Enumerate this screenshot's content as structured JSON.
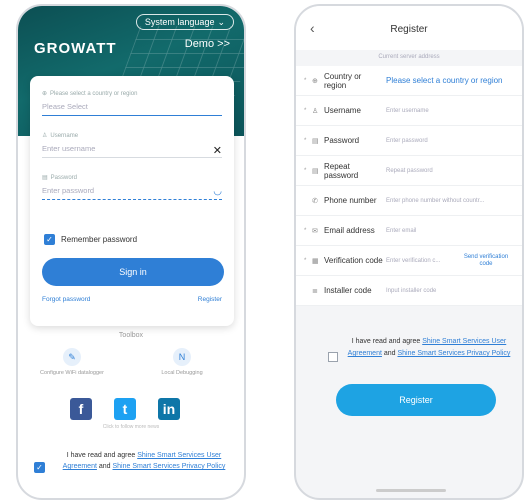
{
  "login": {
    "language": "System language",
    "logo": "GROWATT",
    "demo": "Demo >>",
    "region_label": "Please select a country or region",
    "region_placeholder": "Please Select",
    "username_label": "Username",
    "username_placeholder": "Enter username",
    "password_label": "Password",
    "password_placeholder": "Enter password",
    "remember": "Remember password",
    "sign_in": "Sign in",
    "forgot": "Forgot password",
    "register": "Register",
    "toolbox": "Toolbox",
    "tool_left": "Configure WiFi datalogger",
    "tool_right": "Local Debugging",
    "follow": "Click to follow more news",
    "agree_text": "I have read and agree ",
    "agree_link1": "Shine Smart Services User Agreement",
    "agree_and": " and ",
    "agree_link2": "Shine Smart Services Privacy Policy"
  },
  "register": {
    "title": "Register",
    "server": "Current server address",
    "rows": [
      {
        "label": "Country or region",
        "value": "Please select a country or region",
        "icon": "globe-icon",
        "blue": true
      },
      {
        "label": "Username",
        "value": "Enter username",
        "icon": "user-icon"
      },
      {
        "label": "Password",
        "value": "Enter password",
        "icon": "lock-icon"
      },
      {
        "label": "Repeat password",
        "value": "Repeat password",
        "icon": "lock-icon"
      },
      {
        "label": "Phone number",
        "value": "Enter phone number without countr...",
        "icon": "phone-icon"
      },
      {
        "label": "Email address",
        "value": "Enter email",
        "icon": "mail-icon"
      },
      {
        "label": "Verification code",
        "value": "Enter verification c...",
        "icon": "shield-icon",
        "send": "Send verification code"
      },
      {
        "label": "Installer code",
        "value": "Input installer code",
        "icon": "list-icon"
      }
    ],
    "agree_text": "I have read and agree ",
    "agree_link1": "Shine Smart Services User Agreement",
    "agree_and": " and ",
    "agree_link2": "Shine Smart Services Privacy Policy",
    "button": "Register"
  },
  "colors": {
    "teal": "#0c4f53",
    "blue": "#2f7fd6",
    "register_btn": "#1ea3e3"
  }
}
